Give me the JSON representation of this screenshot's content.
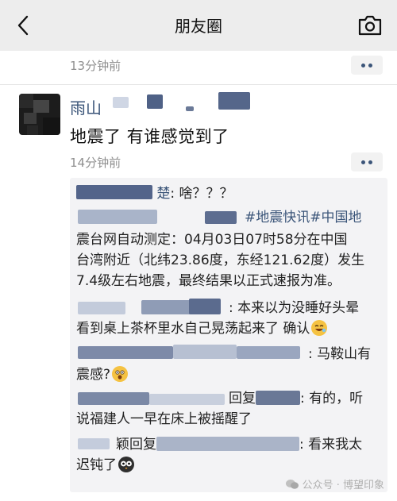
{
  "nav": {
    "title": "朋友圈"
  },
  "feed": {
    "first_time": "13分钟前",
    "post": {
      "author_visible": "雨山",
      "text": "地震了 有谁感觉到了",
      "time": "14分钟前"
    },
    "comments": [
      {
        "name_visible": "楚",
        "sep": ": ",
        "text": "啥？？？"
      },
      {
        "name_visible": "",
        "text_line1": "#地震快讯#中国地",
        "text_line2": "震台网自动测定：04月03日07时58分在中国",
        "text_line3": "台湾附近（北纬23.86度，东经121.62度）发生",
        "text_line4": "7.4级左右地震，最终结果以正式速报为准。"
      },
      {
        "name_visible": "",
        "sep": ": ",
        "text_line1": "本来以为没睡好头晕",
        "text_line2": "看到桌上茶杯里水自己晃荡起来了 确认"
      },
      {
        "name_visible": "",
        "sep": ": ",
        "text_line1": "马鞍山有",
        "text_line2": "震感?"
      },
      {
        "reply_label": "回复",
        "name_visible": "",
        "sep": ": ",
        "text_line1": "有的，听",
        "text_line2": "说福建人一早在床上被摇醒了"
      },
      {
        "reply_label": "颖回复",
        "name_visible": "",
        "sep": ": ",
        "text_line1": "看来我太",
        "text_line2": "迟钝了"
      }
    ]
  },
  "watermark": {
    "text": "公众号 · 博望印象"
  },
  "colors": {
    "link": "#3b5579",
    "nav_bg": "#ededed",
    "comment_bg": "#f3f3f5",
    "time": "#8f8f8f"
  }
}
